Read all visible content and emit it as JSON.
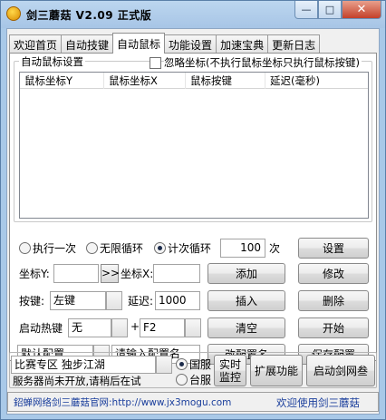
{
  "window": {
    "title": "剑三蘑菇 V2.09 正式版",
    "minimize": "—",
    "maximize": "□",
    "close": "✕"
  },
  "tabs": [
    {
      "label": "欢迎首页",
      "active": false
    },
    {
      "label": "自动技键",
      "active": false
    },
    {
      "label": "自动鼠标",
      "active": true
    },
    {
      "label": "功能设置",
      "active": false
    },
    {
      "label": "加速宝典",
      "active": false
    },
    {
      "label": "更新日志",
      "active": false
    }
  ],
  "mouse": {
    "group_label": "自动鼠标设置",
    "ignore_coords_label": "忽略坐标(不执行鼠标坐标只执行鼠标按键)",
    "ignore_coords_checked": false,
    "columns": [
      "鼠标坐标Y",
      "鼠标坐标X",
      "鼠标按键",
      "延迟(毫秒)"
    ],
    "rows": [],
    "mode_once": "执行一次",
    "mode_infinite": "无限循环",
    "mode_count": "计次循环",
    "selected_mode": "count",
    "count_value": "100",
    "count_unit": "次",
    "settings_button": "设置",
    "coord_y_label": "坐标Y:",
    "coord_y_value": "",
    "arrow_button": ">>",
    "coord_x_label": "坐标X:",
    "coord_x_value": "",
    "add_button": "添加",
    "modify_button": "修改",
    "key_label": "按键:",
    "key_value": "左键",
    "delay_label": "延迟:",
    "delay_value": "1000",
    "insert_button": "插入",
    "delete_button": "删除",
    "hotkey_label": "启动热键",
    "hotkey_mod_value": "无",
    "hotkey_plus": "+",
    "hotkey_key_value": "F2",
    "clear_button": "清空",
    "start_button": "开始",
    "config_value": "默认配置",
    "config_name_placeholder": "请输入配置名",
    "rename_button": "改配置名",
    "save_button": "保存配置"
  },
  "bottom": {
    "zone_value": "比赛专区 独步江湖",
    "server_status": "服务器尚未开放,请稍后在试",
    "region_cn": "国服",
    "region_tw": "台服",
    "selected_region": "cn",
    "realtime_button": "实时\n监控",
    "extend_button": "扩展功能",
    "launch_button": "启动剑网叁"
  },
  "statusbar": {
    "left": "鉊蝉网络剑三蘑菇官网:http://www.jx3mogu.com",
    "right": "欢迎使用剑三蘑菇"
  }
}
